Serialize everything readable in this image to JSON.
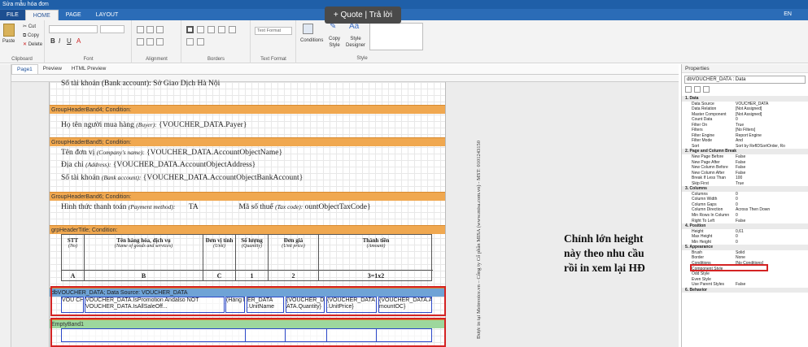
{
  "window": {
    "title": "Sửa mẫu hóa đơn"
  },
  "tabs": {
    "file": "FILE",
    "home": "HOME",
    "page": "PAGE",
    "layout": "LAYOUT",
    "lang": "EN"
  },
  "tooltip": {
    "quote": "+ Quote | Trả lời"
  },
  "ribbon": {
    "paste": "Paste",
    "cut": "Cut",
    "copy": "Copy",
    "delete": "Delete",
    "clipboard": "Clipboard",
    "font": "Font",
    "alignment": "Alignment",
    "borders": "Borders",
    "text_format_box": "Text Format",
    "text_format": "Text Format",
    "conditions": "Conditions",
    "copy_style": "Copy Style",
    "style_designer": "Style Designer",
    "style": "Style"
  },
  "doc_tabs": {
    "page1": "Page1",
    "preview": "Preview",
    "html_preview": "HTML Preview"
  },
  "report": {
    "top_line": "Số tài khoản (Bank account): Sở Giao Dịch Hà Nội",
    "band4": "GroupHeaderBand4; Condition:",
    "buyer_label": "Họ tên người mua hàng",
    "buyer_en": "(Buyer):",
    "buyer_val": "{VOUCHER_DATA.Payer}",
    "band5": "GroupHeaderBand5; Condition:",
    "company_label": "Tên đơn vị",
    "company_en": "(Company's name):",
    "company_val": "{VOUCHER_DATA.AccountObjectName}",
    "address_label": "Địa chỉ",
    "address_en": "(Address):",
    "address_val": "{VOUCHER_DATA.AccountObjectAddress}",
    "bank_label": "Số tài khoản",
    "bank_en": "(Bank account):",
    "bank_val": "{VOUCHER_DATA.AccountObjectBankAccount}",
    "band6": "GroupHeaderBand6; Condition:",
    "pay_label": "Hình thức thanh toán",
    "pay_en": "(Payment method):",
    "pay_val": "TA",
    "tax_label": "Mã số thuế",
    "tax_en": "(Tax code):",
    "tax_val": "ountObjectTaxCode}",
    "band_title": "grpHeaderTitle; Condition:",
    "columns": [
      {
        "h": "STT",
        "en": "(No)",
        "c": "A"
      },
      {
        "h": "Tên hàng hóa, dịch vụ",
        "en": "(Name of goods and services)",
        "c": "B"
      },
      {
        "h": "Đơn vị tính",
        "en": "(Unit)",
        "c": "C"
      },
      {
        "h": "Số lượng",
        "en": "(Quantity)",
        "c": "1"
      },
      {
        "h": "Đơn giá",
        "en": "(Unit price)",
        "c": "2"
      },
      {
        "h": "Thành tiền",
        "en": "(Amount)",
        "c": "3=1x2"
      }
    ],
    "data_band": "dbVOUCHER_DATA; Data Source: VOUCHER_DATA",
    "cells": [
      "VOU CHER",
      "VOUCHER_DATA.IsPromotion Andalso NOT VOUCHER_DATA.IsAllSaleOff...",
      "(Hàng khuyến",
      "ER_DATA .UnitName",
      "{VOUCHER_D ATA.Quantity}",
      "{VOUCHER_DATA .UnitPrice}",
      "{VOUCHER_DATA.A mountOC}"
    ],
    "empty_band": "EmptyBand1",
    "side_text": "Được in tại Meinvoice.vn – Công ty Cổ phần MISA (www.misa.com.vn) - MST: 0101243150"
  },
  "annotation": {
    "line1": "Chỉnh lớn height",
    "line2": "này theo nhu cầu",
    "line3": "rồi in xem lại HĐ"
  },
  "properties": {
    "header": "Properties",
    "selector": "dbVOUCHER_DATA : Data",
    "rows": [
      {
        "k": "1. Data",
        "cat": true
      },
      {
        "k": "Data Source",
        "v": "VOUCHER_DATA"
      },
      {
        "k": "Data Relation",
        "v": "[Not Assigned]"
      },
      {
        "k": "Master Component",
        "v": "[Not Assigned]"
      },
      {
        "k": "Count Data",
        "v": "0"
      },
      {
        "k": "Filter On",
        "v": "True"
      },
      {
        "k": "Filters",
        "v": "[No Filters]"
      },
      {
        "k": "Filter Engine",
        "v": "Report Engine"
      },
      {
        "k": "Filter Mode",
        "v": "And"
      },
      {
        "k": "Sort",
        "v": "Sort by RefIDSortOrder, Ro"
      },
      {
        "k": "2. Page and Column Break",
        "cat": true
      },
      {
        "k": "New Page Before",
        "v": "False"
      },
      {
        "k": "New Page After",
        "v": "False"
      },
      {
        "k": "New Column Before",
        "v": "False"
      },
      {
        "k": "New Column After",
        "v": "False"
      },
      {
        "k": "Break If Less Than",
        "v": "100"
      },
      {
        "k": "Skip First",
        "v": "True"
      },
      {
        "k": "3. Columns",
        "cat": true
      },
      {
        "k": "Columns",
        "v": "0"
      },
      {
        "k": "Column Width",
        "v": "0"
      },
      {
        "k": "Column Gaps",
        "v": "0"
      },
      {
        "k": "Column Direction",
        "v": "Across Then Down"
      },
      {
        "k": "Min Rows In Column",
        "v": "0"
      },
      {
        "k": "Right To Left",
        "v": "False"
      },
      {
        "k": "4. Position",
        "cat": true
      },
      {
        "k": "Height",
        "v": "0,61",
        "hl": true
      },
      {
        "k": "Max Height",
        "v": "0"
      },
      {
        "k": "Min Height",
        "v": "0"
      },
      {
        "k": "5. Appearance",
        "cat": true
      },
      {
        "k": "Brush",
        "v": "Solid"
      },
      {
        "k": "Border",
        "v": "None"
      },
      {
        "k": "Conditions",
        "v": "[No Conditions]"
      },
      {
        "k": "Component Style",
        "v": ""
      },
      {
        "k": "Odd Style",
        "v": ""
      },
      {
        "k": "Even Style",
        "v": ""
      },
      {
        "k": "Use Parent Styles",
        "v": "False"
      },
      {
        "k": "6. Behavior",
        "cat": true
      }
    ]
  }
}
